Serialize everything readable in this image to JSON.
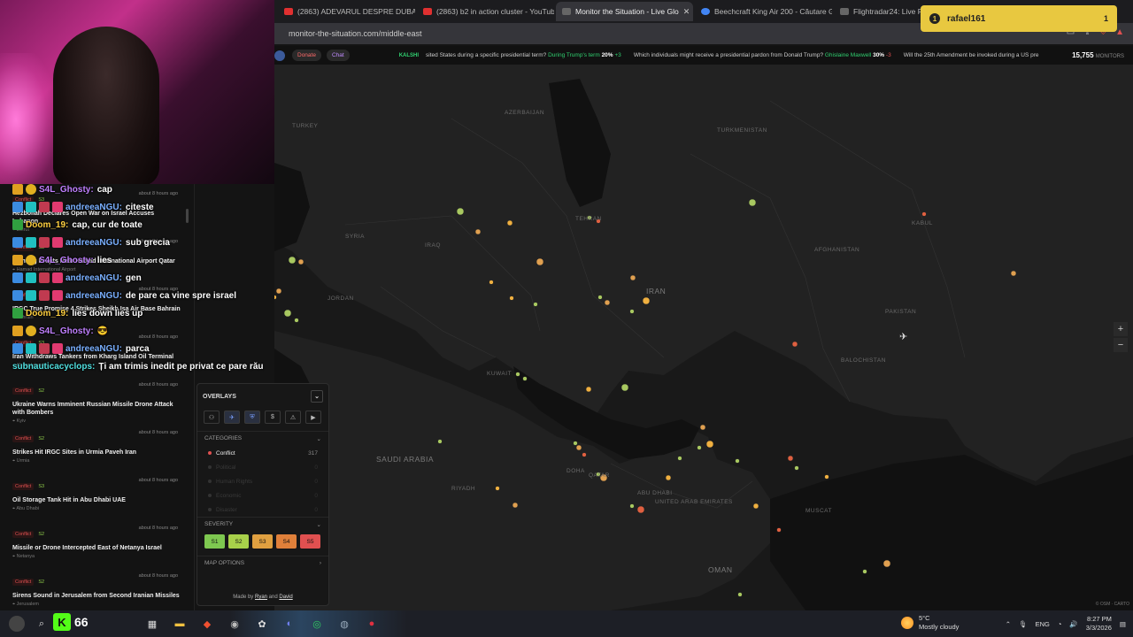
{
  "browser": {
    "tabs": [
      {
        "label": "(2863) ADEVARUL DESPRE DUBAI - Y",
        "icon": "youtube-icon"
      },
      {
        "label": "(2863) b2 in action cluster - YouTube",
        "icon": "youtube-icon"
      },
      {
        "label": "Monitor the Situation - Live Glo",
        "icon": "monitor-icon"
      },
      {
        "label": "Beechcraft King Air 200 - Căutare Go",
        "icon": "google-icon"
      },
      {
        "label": "Flightradar24: Live Flight Tra",
        "icon": "globe-icon"
      }
    ],
    "tab_close": "✕",
    "url": "monitor-the-situation.com/middle-east"
  },
  "alert": {
    "user": "rafael161",
    "badge": "1",
    "count": "1"
  },
  "ticker": {
    "donate": "Donate",
    "chat": "Chat",
    "source": "KALSHI",
    "items": [
      {
        "q": "sited States during a specific presidential term?",
        "ans": "During Trump's term",
        "pct": "20%",
        "chg": "+3",
        "up": true
      },
      {
        "q": "Which individuals might receive a presidential pardon from Donald Trump?",
        "ans": "Ghislaine Maxwell",
        "pct": "30%",
        "chg": "-3",
        "up": false
      },
      {
        "q": "Will the 25th Amendment be invoked during a US pre",
        "ans": "",
        "pct": "",
        "chg": "",
        "up": true
      }
    ],
    "monitors": "15,755",
    "monitors_label": "MONITORS"
  },
  "map": {
    "labels": [
      {
        "t": "AZERBAIJAN",
        "big": false
      },
      {
        "t": "TURKEY",
        "big": false
      },
      {
        "t": "TURKMENISTAN",
        "big": false
      },
      {
        "t": "SYRIA",
        "big": false
      },
      {
        "t": "IRAQ",
        "big": false
      },
      {
        "t": "IRAN",
        "big": true
      },
      {
        "t": "AFGHANISTAN",
        "big": false
      },
      {
        "t": "PAKISTAN",
        "big": false
      },
      {
        "t": "JORDAN",
        "big": false
      },
      {
        "t": "KUWAIT",
        "big": false
      },
      {
        "t": "SAUDI ARABIA",
        "big": true
      },
      {
        "t": "QATAR",
        "big": false
      },
      {
        "t": "UNITED ARAB EMIRATES",
        "big": false
      },
      {
        "t": "OMAN",
        "big": true
      },
      {
        "t": "BALOCHISTAN",
        "big": false
      },
      {
        "t": "KABUL",
        "big": false
      },
      {
        "t": "TEHRAN",
        "big": false
      },
      {
        "t": "RIYADH",
        "big": false
      },
      {
        "t": "ABU DHABI",
        "big": false
      },
      {
        "t": "DOHA",
        "big": false
      },
      {
        "t": "MUSCAT",
        "big": false
      }
    ],
    "zoom_in": "+",
    "zoom_out": "−",
    "attribution": "© OSM · CARTO"
  },
  "news": [
    {
      "tag": "Conflict",
      "sev": "S3",
      "time": "about 8 hours ago",
      "title": "Hezbollah Declares Open War on Israel Accuses Lebanon",
      "loc": "Beirut"
    },
    {
      "tag": "Conflict",
      "sev": "S3",
      "time": "about 8 hours ago",
      "title": "Fighting Erupts Near Hamad International Airport Qatar",
      "loc": "Hamad International Airport"
    },
    {
      "tag": "Conflict",
      "sev": "S4",
      "time": "about 8 hours ago",
      "title": "IRGC True Promise 4 Strikes Sheikh Isa Air Base Bahrain",
      "loc": "Bahrain"
    },
    {
      "tag": "Conflict",
      "sev": "S3",
      "time": "about 8 hours ago",
      "title": "Iran Withdraws Tankers from Kharg Island Oil Terminal",
      "loc": "Kharg Island"
    },
    {
      "tag": "Conflict",
      "sev": "S2",
      "time": "about 8 hours ago",
      "title": "Ukraine Warns Imminent Russian Missile Drone Attack with Bombers",
      "loc": "Kyiv"
    },
    {
      "tag": "Conflict",
      "sev": "S2",
      "time": "about 8 hours ago",
      "title": "Strikes Hit IRGC Sites in Urmia Paveh Iran",
      "loc": "Urmia"
    },
    {
      "tag": "Conflict",
      "sev": "S3",
      "time": "about 8 hours ago",
      "title": "Oil Storage Tank Hit in Abu Dhabi UAE",
      "loc": "Abu Dhabi"
    },
    {
      "tag": "Conflict",
      "sev": "S2",
      "time": "about 8 hours ago",
      "title": "Missile or Drone Intercepted East of Netanya Israel",
      "loc": "Netanya"
    },
    {
      "tag": "Conflict",
      "sev": "S2",
      "time": "about 8 hours ago",
      "title": "Sirens Sound in Jerusalem from Second Iranian Missiles",
      "loc": "Jerusalem"
    }
  ],
  "chat": [
    {
      "badges": [
        "crown",
        "one"
      ],
      "user": "S4L_Ghosty:",
      "ucls": "u1",
      "msg": "cap"
    },
    {
      "badges": [
        "blue",
        "teal",
        "red",
        "gift"
      ],
      "user": "andreeaNGU:",
      "ucls": "u2",
      "msg": "citeste"
    },
    {
      "badges": [
        "grn"
      ],
      "user": "Doom_19:",
      "ucls": "u3",
      "msg": "cap, cur de toate"
    },
    {
      "badges": [
        "blue",
        "teal",
        "red",
        "gift"
      ],
      "user": "andreeaNGU:",
      "ucls": "u2",
      "msg": "sub grecia"
    },
    {
      "badges": [
        "crown",
        "one"
      ],
      "user": "S4L_Ghosty:",
      "ucls": "u1",
      "msg": "lies"
    },
    {
      "badges": [
        "blue",
        "teal",
        "red",
        "gift"
      ],
      "user": "andreeaNGU:",
      "ucls": "u2",
      "msg": "gen"
    },
    {
      "badges": [
        "blue",
        "teal",
        "red",
        "gift"
      ],
      "user": "andreeaNGU:",
      "ucls": "u2",
      "msg": "de pare ca vine spre israel"
    },
    {
      "badges": [
        "grn"
      ],
      "user": "Doom_19:",
      "ucls": "u3",
      "msg": "lies down lies up"
    },
    {
      "badges": [
        "crown",
        "one"
      ],
      "user": "S4L_Ghosty:",
      "ucls": "u1",
      "msg": "😎"
    },
    {
      "badges": [
        "blue",
        "teal",
        "red",
        "gift"
      ],
      "user": "andreeaNGU:",
      "ucls": "u2",
      "msg": "parca"
    },
    {
      "badges": [],
      "user": "subnauticacyclops:",
      "ucls": "u4",
      "msg": "Ți am trimis inedit pe privat ce pare rău"
    }
  ],
  "panel": {
    "title": "OVERLAYS",
    "chevron": "⌄",
    "icons": [
      {
        "g": "⚇",
        "name": "people-icon",
        "on": false
      },
      {
        "g": "✈",
        "name": "plane-icon",
        "on": true
      },
      {
        "g": "⛨",
        "name": "shield-icon",
        "on": true
      },
      {
        "g": "$",
        "name": "dollar-icon",
        "on": false
      },
      {
        "g": "⚠",
        "name": "warning-icon",
        "on": false
      },
      {
        "g": "▶",
        "name": "video-icon",
        "on": false
      }
    ],
    "categories_label": "CATEGORIES",
    "categories": [
      {
        "label": "Conflict",
        "count": "317",
        "on": true
      },
      {
        "label": "Political",
        "count": "0",
        "on": false
      },
      {
        "label": "Human Rights",
        "count": "0",
        "on": false
      },
      {
        "label": "Economic",
        "count": "0",
        "on": false
      },
      {
        "label": "Disaster",
        "count": "0",
        "on": false
      }
    ],
    "severity_label": "SEVERITY",
    "severity": [
      {
        "label": "S1",
        "color": "#7ec850"
      },
      {
        "label": "S2",
        "color": "#a8d04a"
      },
      {
        "label": "S3",
        "color": "#e0a040"
      },
      {
        "label": "S4",
        "color": "#e0803a"
      },
      {
        "label": "S5",
        "color": "#e05050"
      }
    ],
    "map_options_label": "MAP OPTIONS",
    "arrow": "›",
    "credit_pre": "Made by",
    "credit_a": "Ryan",
    "credit_and": "and",
    "credit_b": "David"
  },
  "taskbar": {
    "kick_count": "66",
    "apps": [
      "search-icon",
      "widgets-icon",
      "explorer-icon",
      "brave-icon",
      "obs-icon",
      "chatgpt-icon",
      "discord-icon",
      "spotify-icon",
      "steam-icon",
      "game-icon"
    ],
    "weather_temp": "5°C",
    "weather_desc": "Mostly cloudy",
    "lang": "ENG",
    "time": "8:27 PM",
    "date": "3/3/2026"
  }
}
